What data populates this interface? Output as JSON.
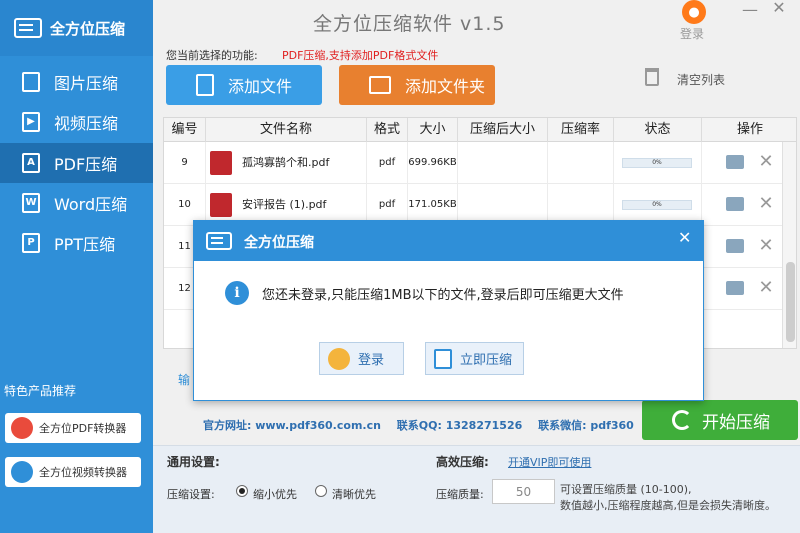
{
  "app": {
    "logo_text": "全方位压缩",
    "title": "全方位压缩软件 v1.5",
    "login_label": "登录",
    "minimize_glyph": "—",
    "close_glyph": "✕"
  },
  "sidebar": {
    "items": [
      {
        "label": "图片压缩",
        "icon": "image-icon",
        "glyph": ""
      },
      {
        "label": "视频压缩",
        "icon": "video-icon",
        "glyph": "▶"
      },
      {
        "label": "PDF压缩",
        "icon": "pdf-icon",
        "glyph": "A",
        "active": true
      },
      {
        "label": "Word压缩",
        "icon": "word-icon",
        "glyph": "W"
      },
      {
        "label": "PPT压缩",
        "icon": "ppt-icon",
        "glyph": "P"
      }
    ],
    "featured_title": "特色产品推荐",
    "featured": [
      {
        "label": "全方位PDF转换器",
        "icon": "pdf-converter-icon",
        "color": "#e94b3c"
      },
      {
        "label": "全方位视频转换器",
        "icon": "video-converter-icon",
        "color": "#2f8fd8"
      }
    ]
  },
  "function_line": {
    "label": "您当前选择的功能:",
    "value": "PDF压缩,支持添加PDF格式文件"
  },
  "toolbar": {
    "add_file": "添加文件",
    "add_folder": "添加文件夹",
    "clear_list": "清空列表"
  },
  "table": {
    "columns": [
      "编号",
      "文件名称",
      "格式",
      "大小",
      "压缩后大小",
      "压缩率",
      "状态",
      "操作"
    ],
    "rows": [
      {
        "no": "9",
        "name": "孤鸿寡鹄个和.pdf",
        "format": "pdf",
        "size": "699.96KB",
        "compressed": "",
        "ratio": "",
        "progress": "0%"
      },
      {
        "no": "10",
        "name": "安评报告 (1).pdf",
        "format": "pdf",
        "size": "171.05KB",
        "compressed": "",
        "ratio": "",
        "progress": "0%"
      },
      {
        "no": "11",
        "name": "",
        "format": "",
        "size": "",
        "compressed": "",
        "ratio": "",
        "progress": ""
      },
      {
        "no": "12",
        "name": "",
        "format": "",
        "size": "",
        "compressed": "",
        "ratio": "",
        "progress": ""
      }
    ]
  },
  "output_label": "输",
  "contact": {
    "website": "官方网址: www.pdf360.com.cn",
    "qq": "联系QQ: 1328271526",
    "wechat": "联系微信: pdf360"
  },
  "start_button": "开始压缩",
  "settings": {
    "general_title": "通用设置:",
    "compress_setting_label": "压缩设置:",
    "option_small": "缩小优先",
    "option_clear": "清晰优先",
    "efficient_title": "高效压缩:",
    "vip_link": "开通VIP即可使用",
    "quality_label": "压缩质量:",
    "quality_value": "50",
    "quality_hint1": "可设置压缩质量 (10-100),",
    "quality_hint2": "数值越小,压缩程度越高,但是会损失清晰度。"
  },
  "modal": {
    "title": "全方位压缩",
    "close_glyph": "✕",
    "info_glyph": "i",
    "message": "您还未登录,只能压缩1MB以下的文件,登录后即可压缩更大文件",
    "login_button": "登录",
    "compress_button": "立即压缩"
  }
}
